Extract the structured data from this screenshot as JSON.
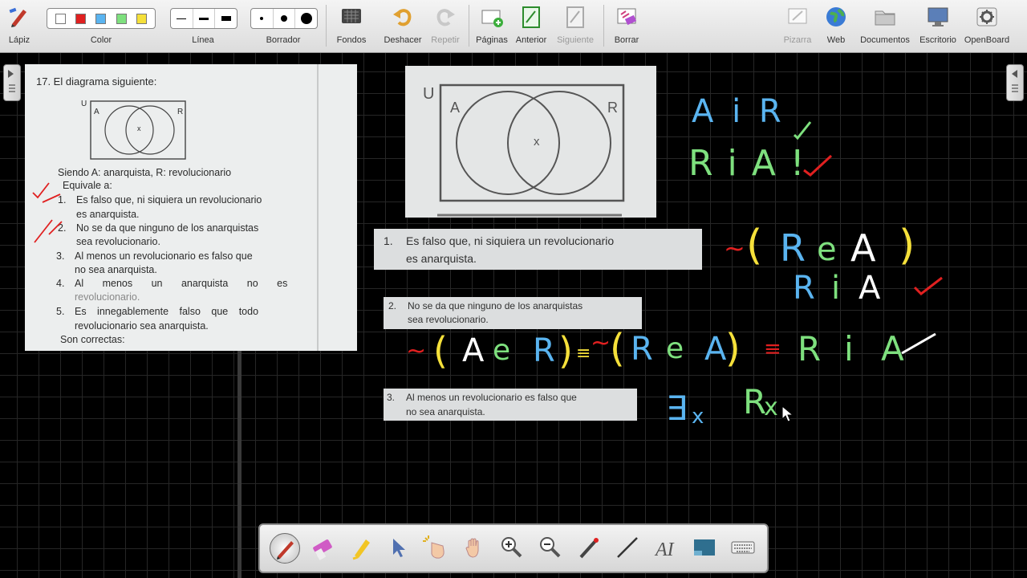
{
  "toolbar": {
    "pen": "Lápiz",
    "color": "Color",
    "line": "Línea",
    "eraser": "Borrador",
    "backgrounds": "Fondos",
    "undo": "Deshacer",
    "redo": "Repetir",
    "pages": "Páginas",
    "previous": "Anterior",
    "next": "Siguiente",
    "erase": "Borrar",
    "board": "Pizarra",
    "web": "Web",
    "documents": "Documentos",
    "desktop": "Escritorio",
    "app": "OpenBoard",
    "colors": [
      "#ffffff",
      "#e02020",
      "#5ab4f0",
      "#7ee07e",
      "#f5e03a"
    ]
  },
  "exercise": {
    "title": "17. El diagrama siguiente:",
    "venn_u": "U",
    "venn_a": "A",
    "venn_r": "R",
    "venn_x": "x",
    "condition": "Siendo A: anarquista, R: revolucionario",
    "equiv": "Equivale a:",
    "o1_num": "1.",
    "o1_a": "Es falso que, ni siquiera un revolucionario",
    "o1_b": "es anarquista.",
    "o2_num": "2.",
    "o2_a": "No se da que ninguno de los anarquistas",
    "o2_b": "sea revolucionario.",
    "o3_num": "3.",
    "o3_a": "Al menos un revolucionario es falso que",
    "o3_b": "no sea anarquista.",
    "o4_num": "4.",
    "o4_a": "Al menos un anarquista no es",
    "o4_b": "revolucionario.",
    "o5_num": "5.",
    "o5_a": "Es innegablemente falso que todo",
    "o5_b": "revolucionario sea anarquista.",
    "footer": "Son correctas:"
  },
  "venn_zoom": {
    "u": "U",
    "a": "A",
    "r": "R",
    "x": "x"
  },
  "strips": {
    "s1_num": "1.",
    "s1_a": "Es falso que, ni siquiera un revolucionario",
    "s1_b": "es anarquista.",
    "s2_num": "2.",
    "s2_a": "No se da que ninguno de los anarquistas",
    "s2_b": "sea revolucionario.",
    "s3_num": "3.",
    "s3_a": "Al menos un revolucionario es falso que",
    "s3_b": "no sea anarquista."
  },
  "handwriting": {
    "h1": "A i R",
    "h2": "R i A !",
    "h3_tilde": "~",
    "h3_lp": "(",
    "h3_r": "R",
    "h3_e": "e",
    "h3_a": "A",
    "h3_rp": ")",
    "h4_r": "R",
    "h4_i": "i",
    "h4_a": "A",
    "h5_tilde1": "~",
    "h5_lp1": "(",
    "h5_a1": "A",
    "h5_e1": "e",
    "h5_r1": "R",
    "h5_rp1": ")",
    "h5_eq1": "≡",
    "h5_tilde2": "~",
    "h5_lp2": "(",
    "h5_r2": "R",
    "h5_e2": "e",
    "h5_a2": "A",
    "h5_rp2": ")",
    "h5_eq2": "≡",
    "h5_r3": "R",
    "h5_i3": "i",
    "h5_a3": "A",
    "h6_exists": "∃",
    "h6_sub": "x",
    "h6_r": "R",
    "h6_x": "x"
  },
  "palette": [
    "pen-tool",
    "eraser-tool",
    "marker-tool",
    "selector-tool",
    "interactor-tool",
    "hand-tool",
    "zoom-in-tool",
    "zoom-out-tool",
    "laser-tool",
    "line-tool",
    "text-tool",
    "capture-tool",
    "keyboard-tool"
  ]
}
